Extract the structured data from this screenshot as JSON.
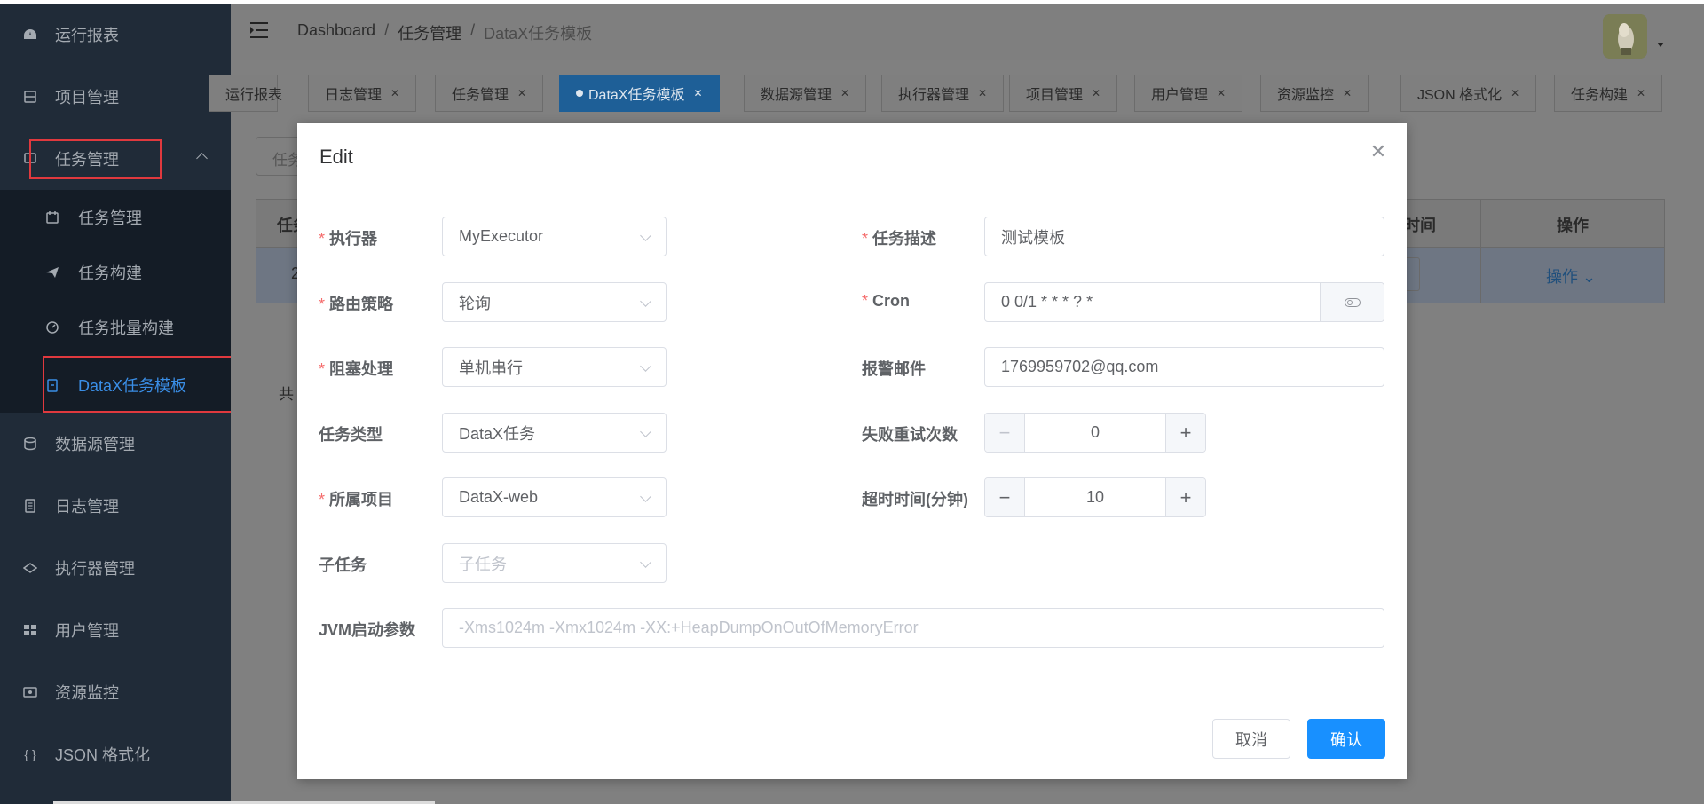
{
  "sidebar": {
    "items": [
      {
        "label": "运行报表",
        "icon": "dashboard-icon"
      },
      {
        "label": "项目管理",
        "icon": "project-icon"
      },
      {
        "label": "任务管理",
        "icon": "task-icon"
      },
      {
        "label": "数据源管理",
        "icon": "database-icon"
      },
      {
        "label": "日志管理",
        "icon": "log-icon"
      },
      {
        "label": "执行器管理",
        "icon": "executor-icon"
      },
      {
        "label": "用户管理",
        "icon": "user-icon"
      },
      {
        "label": "资源监控",
        "icon": "monitor-icon"
      },
      {
        "label": "JSON 格式化",
        "icon": "braces-icon"
      }
    ],
    "submenu": [
      {
        "label": "任务管理",
        "icon": "calendar-icon"
      },
      {
        "label": "任务构建",
        "icon": "paper-plane-icon"
      },
      {
        "label": "任务批量构建",
        "icon": "gauge-icon"
      },
      {
        "label": "DataX任务模板",
        "icon": "clipboard-icon",
        "active": true
      }
    ],
    "active_color": "#3a8ee6",
    "highlight_color": "#e0393e"
  },
  "header": {
    "breadcrumb": [
      "Dashboard",
      "任务管理",
      "DataX任务模板"
    ],
    "separator": "/"
  },
  "tags": [
    {
      "label": "运行报表"
    },
    {
      "label": "日志管理"
    },
    {
      "label": "任务管理"
    },
    {
      "label": "DataX任务模板",
      "active": true
    },
    {
      "label": "数据源管理"
    },
    {
      "label": "执行器管理"
    },
    {
      "label": "项目管理"
    },
    {
      "label": "用户管理"
    },
    {
      "label": "资源监控"
    },
    {
      "label": "JSON 格式化"
    },
    {
      "label": "任务构建"
    }
  ],
  "background": {
    "search_placeholder": "任务",
    "table_col_first": "任务",
    "table_col_time": "时间",
    "table_col_ops": "操作",
    "row_first": "2",
    "ops_link": "操作",
    "total_label": "共"
  },
  "modal": {
    "title": "Edit",
    "close_icon": "close-icon",
    "fields": {
      "executor": {
        "label": "执行器",
        "required": true,
        "value": "MyExecutor"
      },
      "route": {
        "label": "路由策略",
        "required": true,
        "value": "轮询"
      },
      "block": {
        "label": "阻塞处理",
        "required": true,
        "value": "单机串行"
      },
      "task_type": {
        "label": "任务类型",
        "required": false,
        "value": "DataX任务"
      },
      "project": {
        "label": "所属项目",
        "required": true,
        "value": "DataX-web"
      },
      "child_task": {
        "label": "子任务",
        "required": false,
        "value": "",
        "placeholder": "子任务"
      },
      "jvm": {
        "label": "JVM启动参数",
        "required": false,
        "value": "",
        "placeholder": "-Xms1024m -Xmx1024m -XX:+HeapDumpOnOutOfMemoryError"
      },
      "desc": {
        "label": "任务描述",
        "required": true,
        "value": "测试模板"
      },
      "cron": {
        "label": "Cron",
        "required": true,
        "value": "0 0/1 * * * ? *"
      },
      "alarm_email": {
        "label": "报警邮件",
        "required": false,
        "value": "1769959702@qq.com"
      },
      "retry": {
        "label": "失败重试次数",
        "required": false,
        "value": "0"
      },
      "timeout": {
        "label": "超时时间(分钟)",
        "required": false,
        "value": "10"
      }
    },
    "required_mark": "*",
    "minus_symbol": "−",
    "plus_symbol": "+",
    "cancel_label": "取消",
    "confirm_label": "确认",
    "primary_color": "#1890ff"
  }
}
